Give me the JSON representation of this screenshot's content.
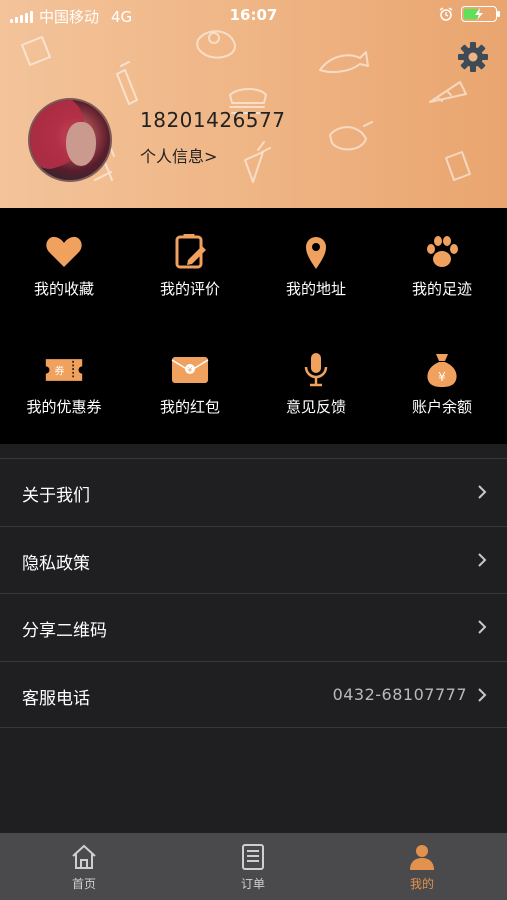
{
  "status_bar": {
    "carrier": "中国移动",
    "network": "4G",
    "time": "16:07"
  },
  "profile": {
    "phone": "18201426577",
    "info_link": "个人信息>"
  },
  "icons": {
    "settings": "gear-icon",
    "avatar": "user-photo"
  },
  "grid": [
    {
      "label": "我的收藏",
      "icon": "heart-icon"
    },
    {
      "label": "我的评价",
      "icon": "edit-note-icon"
    },
    {
      "label": "我的地址",
      "icon": "location-pin-icon"
    },
    {
      "label": "我的足迹",
      "icon": "paw-icon"
    },
    {
      "label": "我的优惠券",
      "icon": "coupon-icon",
      "badge": "券"
    },
    {
      "label": "我的红包",
      "icon": "red-envelope-icon"
    },
    {
      "label": "意见反馈",
      "icon": "microphone-icon"
    },
    {
      "label": "账户余额",
      "icon": "money-bag-icon"
    }
  ],
  "list": [
    {
      "label": "关于我们"
    },
    {
      "label": "隐私政策"
    },
    {
      "label": "分享二维码"
    },
    {
      "label": "客服电话",
      "value": "0432-68107777"
    }
  ],
  "tabs": [
    {
      "label": "首页",
      "icon": "home-icon",
      "active": false
    },
    {
      "label": "订单",
      "icon": "order-list-icon",
      "active": false
    },
    {
      "label": "我的",
      "icon": "user-icon",
      "active": true
    }
  ],
  "colors": {
    "accent": "#e9a56f",
    "active_tab": "#e2924e",
    "background": "#1f1f21",
    "grid_background": "#000000"
  }
}
